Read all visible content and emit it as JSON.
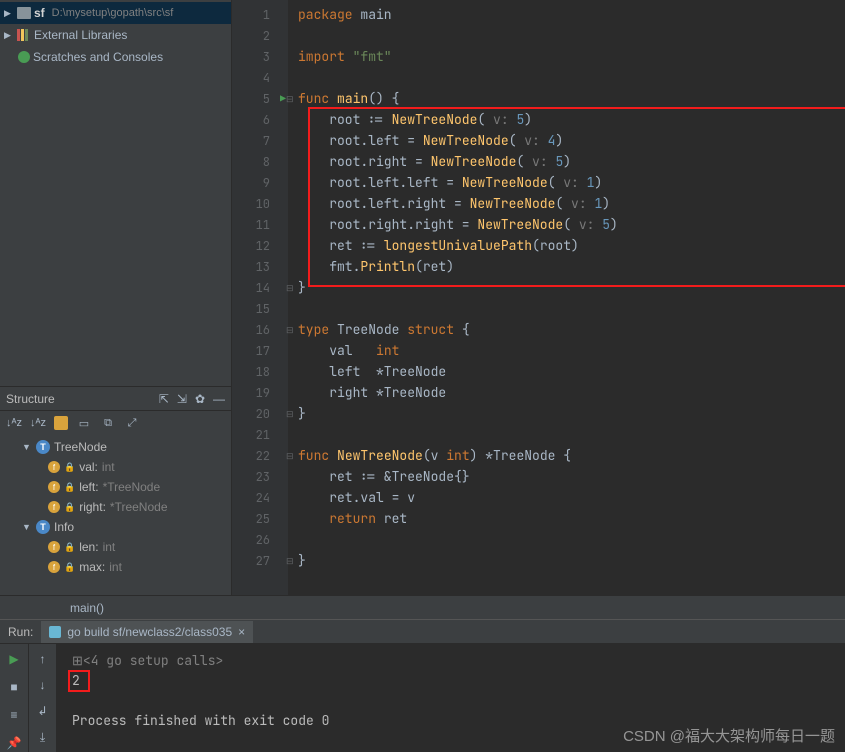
{
  "project": {
    "root_name": "sf",
    "root_path": "D:\\mysetup\\gopath\\src\\sf",
    "ext_libs": "External Libraries",
    "scratches": "Scratches and Consoles"
  },
  "structure": {
    "title": "Structure",
    "items": [
      {
        "name": "TreeNode",
        "kind": "T"
      },
      {
        "name": "val:",
        "type": "int",
        "kind": "f"
      },
      {
        "name": "left:",
        "type": "*TreeNode",
        "kind": "f"
      },
      {
        "name": "right:",
        "type": "*TreeNode",
        "kind": "f"
      },
      {
        "name": "Info",
        "kind": "T"
      },
      {
        "name": "len:",
        "type": "int",
        "kind": "f"
      },
      {
        "name": "max:",
        "type": "int",
        "kind": "f"
      }
    ]
  },
  "editor": {
    "lines": [
      {
        "n": 1,
        "seg": [
          {
            "t": "package ",
            "c": "kw"
          },
          {
            "t": "main",
            "c": ""
          }
        ]
      },
      {
        "n": 2,
        "seg": []
      },
      {
        "n": 3,
        "seg": [
          {
            "t": "import ",
            "c": "kw"
          },
          {
            "t": "\"fmt\"",
            "c": "str"
          }
        ]
      },
      {
        "n": 4,
        "seg": []
      },
      {
        "n": 5,
        "run": true,
        "fold": "-",
        "seg": [
          {
            "t": "func ",
            "c": "kw"
          },
          {
            "t": "main",
            "c": "fn"
          },
          {
            "t": "() {",
            "c": ""
          }
        ]
      },
      {
        "n": 6,
        "seg": [
          {
            "t": "    root := ",
            "c": ""
          },
          {
            "t": "NewTreeNode",
            "c": "fn"
          },
          {
            "t": "( ",
            "c": ""
          },
          {
            "t": "v: ",
            "c": "hint"
          },
          {
            "t": "5",
            "c": "num"
          },
          {
            "t": ")",
            "c": ""
          }
        ]
      },
      {
        "n": 7,
        "seg": [
          {
            "t": "    root.left = ",
            "c": ""
          },
          {
            "t": "NewTreeNode",
            "c": "fn"
          },
          {
            "t": "( ",
            "c": ""
          },
          {
            "t": "v: ",
            "c": "hint"
          },
          {
            "t": "4",
            "c": "num"
          },
          {
            "t": ")",
            "c": ""
          }
        ]
      },
      {
        "n": 8,
        "seg": [
          {
            "t": "    root.right = ",
            "c": ""
          },
          {
            "t": "NewTreeNode",
            "c": "fn"
          },
          {
            "t": "( ",
            "c": ""
          },
          {
            "t": "v: ",
            "c": "hint"
          },
          {
            "t": "5",
            "c": "num"
          },
          {
            "t": ")",
            "c": ""
          }
        ]
      },
      {
        "n": 9,
        "seg": [
          {
            "t": "    root.left.left = ",
            "c": ""
          },
          {
            "t": "NewTreeNode",
            "c": "fn"
          },
          {
            "t": "( ",
            "c": ""
          },
          {
            "t": "v: ",
            "c": "hint"
          },
          {
            "t": "1",
            "c": "num"
          },
          {
            "t": ")",
            "c": ""
          }
        ]
      },
      {
        "n": 10,
        "seg": [
          {
            "t": "    root.left.right = ",
            "c": ""
          },
          {
            "t": "NewTreeNode",
            "c": "fn"
          },
          {
            "t": "( ",
            "c": ""
          },
          {
            "t": "v: ",
            "c": "hint"
          },
          {
            "t": "1",
            "c": "num"
          },
          {
            "t": ")",
            "c": ""
          }
        ]
      },
      {
        "n": 11,
        "seg": [
          {
            "t": "    root.right.right = ",
            "c": ""
          },
          {
            "t": "NewTreeNode",
            "c": "fn"
          },
          {
            "t": "( ",
            "c": ""
          },
          {
            "t": "v: ",
            "c": "hint"
          },
          {
            "t": "5",
            "c": "num"
          },
          {
            "t": ")",
            "c": ""
          }
        ]
      },
      {
        "n": 12,
        "seg": [
          {
            "t": "    ret := ",
            "c": ""
          },
          {
            "t": "longestUnivaluePath",
            "c": "fn"
          },
          {
            "t": "(root)",
            "c": ""
          }
        ]
      },
      {
        "n": 13,
        "seg": [
          {
            "t": "    fmt.",
            "c": ""
          },
          {
            "t": "Println",
            "c": "fn"
          },
          {
            "t": "(ret)",
            "c": ""
          }
        ]
      },
      {
        "n": 14,
        "fold": "-",
        "seg": [
          {
            "t": "}",
            "c": ""
          }
        ]
      },
      {
        "n": 15,
        "seg": []
      },
      {
        "n": 16,
        "fold": "-",
        "seg": [
          {
            "t": "type ",
            "c": "kw"
          },
          {
            "t": "TreeNode ",
            "c": ""
          },
          {
            "t": "struct",
            "c": "kw"
          },
          {
            "t": " {",
            "c": ""
          }
        ]
      },
      {
        "n": 17,
        "seg": [
          {
            "t": "    val   ",
            "c": ""
          },
          {
            "t": "int",
            "c": "kw"
          }
        ]
      },
      {
        "n": 18,
        "seg": [
          {
            "t": "    left  *TreeNode",
            "c": ""
          }
        ]
      },
      {
        "n": 19,
        "seg": [
          {
            "t": "    right *TreeNode",
            "c": ""
          }
        ]
      },
      {
        "n": 20,
        "fold": "-",
        "seg": [
          {
            "t": "}",
            "c": ""
          }
        ]
      },
      {
        "n": 21,
        "seg": []
      },
      {
        "n": 22,
        "fold": "-",
        "seg": [
          {
            "t": "func ",
            "c": "kw"
          },
          {
            "t": "NewTreeNode",
            "c": "fn"
          },
          {
            "t": "(v ",
            "c": ""
          },
          {
            "t": "int",
            "c": "kw"
          },
          {
            "t": ") *TreeNode {",
            "c": ""
          }
        ]
      },
      {
        "n": 23,
        "seg": [
          {
            "t": "    ret := &TreeNode{}",
            "c": ""
          }
        ]
      },
      {
        "n": 24,
        "seg": [
          {
            "t": "    ret.val = v",
            "c": ""
          }
        ]
      },
      {
        "n": 25,
        "seg": [
          {
            "t": "    ",
            "c": ""
          },
          {
            "t": "return ",
            "c": "kw"
          },
          {
            "t": "ret",
            "c": ""
          }
        ]
      },
      {
        "n": 26,
        "seg": []
      },
      {
        "n": 27,
        "fold": "-",
        "seg": [
          {
            "t": "}",
            "c": ""
          }
        ]
      }
    ],
    "context": "main()"
  },
  "run": {
    "label": "Run:",
    "tab": "go build sf/newclass2/class035",
    "setup": "<4 go setup calls>",
    "output": "2",
    "exit": "Process finished with exit code 0"
  },
  "watermark": "CSDN @福大大架构师每日一题"
}
